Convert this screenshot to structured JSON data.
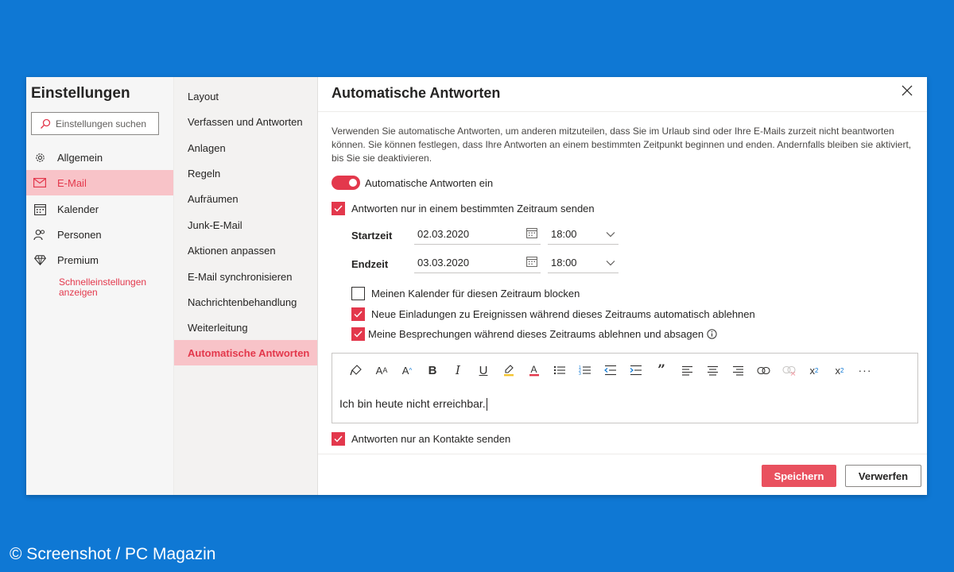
{
  "settings": {
    "title": "Einstellungen",
    "search_placeholder": "Einstellungen suchen",
    "categories": [
      {
        "label": "Allgemein",
        "icon": "gear-icon"
      },
      {
        "label": "E-Mail",
        "icon": "mail-icon"
      },
      {
        "label": "Kalender",
        "icon": "calendar-icon"
      },
      {
        "label": "Personen",
        "icon": "people-icon"
      },
      {
        "label": "Premium",
        "icon": "diamond-icon"
      }
    ],
    "quick_settings_label": "Schnelleinstellungen anzeigen"
  },
  "mail_nav": {
    "items": [
      "Layout",
      "Verfassen und Antworten",
      "Anlagen",
      "Regeln",
      "Aufräumen",
      "Junk-E-Mail",
      "Aktionen anpassen",
      "E-Mail synchronisieren",
      "Nachrichtenbehandlung",
      "Weiterleitung",
      "Automatische Antworten"
    ]
  },
  "panel": {
    "title": "Automatische Antworten",
    "description": "Verwenden Sie automatische Antworten, um anderen mitzuteilen, dass Sie im Urlaub sind oder Ihre E-Mails zurzeit nicht beantworten können. Sie können festlegen, dass Ihre Antworten an einem bestimmten Zeitpunkt beginnen und enden. Andernfalls bleiben sie aktiviert, bis Sie sie deaktivieren.",
    "toggle_label": "Automatische Antworten ein",
    "timeframe_label": "Antworten nur in einem bestimmten Zeitraum senden",
    "start_label": "Startzeit",
    "start_date": "02.03.2020",
    "start_time": "18:00",
    "end_label": "Endzeit",
    "end_date": "03.03.2020",
    "end_time": "18:00",
    "block_calendar_label": "Meinen Kalender für diesen Zeitraum blocken",
    "decline_invites_label": "Neue Einladungen zu Ereignissen während dieses Zeitraums automatisch ablehnen",
    "decline_meetings_label": "Meine Besprechungen während dieses Zeitraums ablehnen und absagen",
    "message_text": "Ich bin heute nicht erreichbar.",
    "contacts_only_label": "Antworten nur an Kontakte senden",
    "save_label": "Speichern",
    "discard_label": "Verwerfen"
  },
  "watermark": "© Screenshot / PC Magazin",
  "colors": {
    "accent": "#e3384c",
    "active_bg": "#f8c3c8",
    "background": "#0f78d4"
  }
}
